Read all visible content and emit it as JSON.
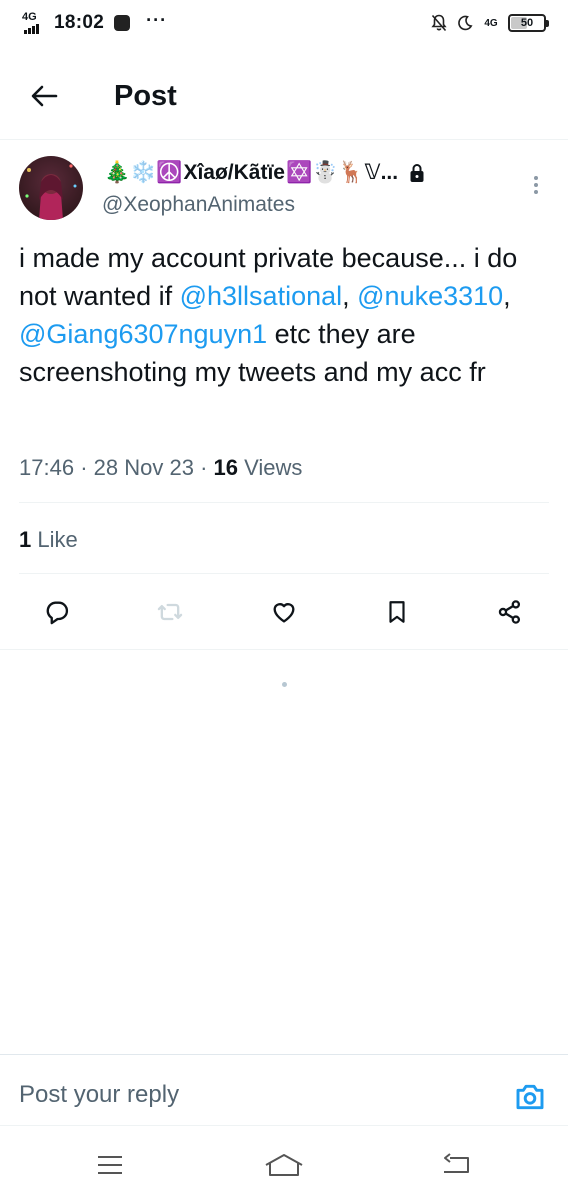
{
  "status_bar": {
    "network": "4G",
    "time": "18:02",
    "more": "···",
    "network_right": "4G",
    "battery": "50",
    "battery_level": 0.5
  },
  "header": {
    "title": "Post",
    "back_icon": "arrow-left-icon"
  },
  "tweet": {
    "display_name_prefix": "🎄❄️☮️",
    "display_name_core": "Xîaø/Kãtïe",
    "display_name_suffix": "✡️☃️🦌𝕍...",
    "handle": "@XeophanAnimates",
    "text_part1": "i made my account private because... i do not wanted if ",
    "mention1": "@h3llsational",
    "text_part2": ", ",
    "mention2": "@nuke3310",
    "text_part3": ", ",
    "mention3": "@Giang6307nguyn1",
    "text_part4": " etc they are screenshoting my tweets and my acc fr",
    "time": "17:46",
    "separator": "·",
    "date": "28 Nov 23",
    "views_count": "16",
    "views_label": "Views",
    "likes_count": "1",
    "likes_label": "Like"
  },
  "actions": [
    {
      "icon": "reply-icon"
    },
    {
      "icon": "repost-icon"
    },
    {
      "icon": "like-icon"
    },
    {
      "icon": "bookmark-icon"
    },
    {
      "icon": "share-icon"
    }
  ],
  "reply": {
    "placeholder": "Post your reply",
    "camera_icon": "camera-icon"
  },
  "nav": {
    "menu_icon": "menu-icon",
    "home_icon": "home-icon",
    "back_icon": "back-nav-icon"
  },
  "colors": {
    "accent": "#1d9bf0",
    "text": "#0f1419",
    "secondary": "#536471",
    "divider": "#eff3f4"
  }
}
